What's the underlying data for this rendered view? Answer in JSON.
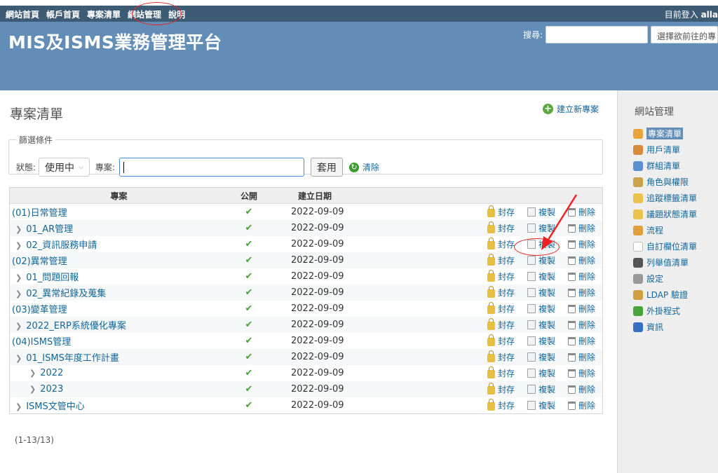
{
  "top_menu": {
    "items": [
      "網站首頁",
      "帳戶首頁",
      "專案清單",
      "網站管理",
      "說明"
    ],
    "logged_as_label": "目前登入",
    "logged_as_user": "alla"
  },
  "header": {
    "title": "MIS及ISMS業務管理平台",
    "search_label": "搜尋:",
    "jump_placeholder": "選擇欲前往的專"
  },
  "main": {
    "title": "專案清單",
    "new_project": "建立新專案",
    "filters": {
      "legend": "篩選條件",
      "status_label": "狀態:",
      "status_value": "使用中",
      "project_label": "專案:",
      "apply": "套用",
      "clear": "清除"
    },
    "table": {
      "headers": {
        "name": "專案",
        "public": "公開",
        "created": "建立日期"
      },
      "actions": {
        "archive": "封存",
        "copy": "複製",
        "delete": "刪除"
      },
      "rows": [
        {
          "name": "(01)日常管理",
          "date": "2022-09-09",
          "level": 0
        },
        {
          "name": "01_AR管理",
          "date": "2022-09-09",
          "level": 1
        },
        {
          "name": "02_資訊服務申請",
          "date": "2022-09-09",
          "level": 1
        },
        {
          "name": "(02)異常管理",
          "date": "2022-09-09",
          "level": 0
        },
        {
          "name": "01_問題回報",
          "date": "2022-09-09",
          "level": 1
        },
        {
          "name": "02_異常紀錄及蒐集",
          "date": "2022-09-09",
          "level": 1
        },
        {
          "name": "(03)變革管理",
          "date": "2022-09-09",
          "level": 0
        },
        {
          "name": "2022_ERP系統優化專案",
          "date": "2022-09-09",
          "level": 1
        },
        {
          "name": "(04)ISMS管理",
          "date": "2022-09-09",
          "level": 0
        },
        {
          "name": "01_ISMS年度工作計畫",
          "date": "2022-09-09",
          "level": 1
        },
        {
          "name": "2022",
          "date": "2022-09-09",
          "level": 2
        },
        {
          "name": "2023",
          "date": "2022-09-09",
          "level": 2
        },
        {
          "name": "ISMS文管中心",
          "date": "2022-09-09",
          "level": 1
        }
      ]
    },
    "pagination": "(1-13/13)"
  },
  "sidebar": {
    "title": "網站管理",
    "items": [
      {
        "label": "專案清單",
        "icon": "projects-icon",
        "color": "#e8a33a",
        "selected": true
      },
      {
        "label": "用戶清單",
        "icon": "user-icon",
        "color": "#d98b3b"
      },
      {
        "label": "群組清單",
        "icon": "group-icon",
        "color": "#5a8fd0"
      },
      {
        "label": "角色與權限",
        "icon": "role-icon",
        "color": "#c9a24a"
      },
      {
        "label": "追蹤標籤清單",
        "icon": "tracker-icon",
        "color": "#e8c24a"
      },
      {
        "label": "議題狀態清單",
        "icon": "status-icon",
        "color": "#e8c24a"
      },
      {
        "label": "流程",
        "icon": "workflow-icon",
        "color": "#e0a040"
      },
      {
        "label": "自訂欄位清單",
        "icon": "custom-field-icon",
        "color": "#ffffff"
      },
      {
        "label": "列舉值清單",
        "icon": "list-icon",
        "color": "#555555"
      },
      {
        "label": "設定",
        "icon": "gear-icon",
        "color": "#999999"
      },
      {
        "label": "LDAP 驗證",
        "icon": "ldap-icon",
        "color": "#d0a040"
      },
      {
        "label": "外掛程式",
        "icon": "plugin-icon",
        "color": "#4aa33a"
      },
      {
        "label": "資訊",
        "icon": "info-icon",
        "color": "#3a6fc0"
      }
    ]
  }
}
